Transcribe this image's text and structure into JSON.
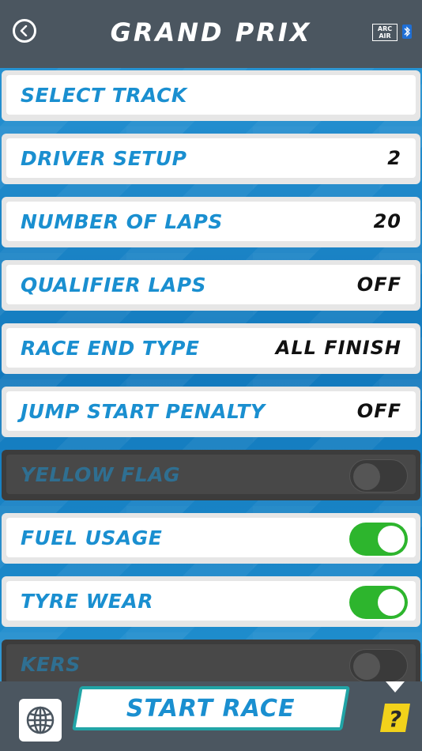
{
  "header": {
    "title": "GRAND PRIX",
    "logo_line1": "ARC",
    "logo_line2": "AIR"
  },
  "settings": [
    {
      "label": "SELECT TRACK",
      "value": ""
    },
    {
      "label": "DRIVER SETUP",
      "value": "2"
    },
    {
      "label": "NUMBER OF LAPS",
      "value": "20"
    },
    {
      "label": "QUALIFIER LAPS",
      "value": "OFF"
    },
    {
      "label": "RACE END TYPE",
      "value": "ALL FINISH"
    },
    {
      "label": "JUMP START  PENALTY",
      "value": "OFF"
    }
  ],
  "toggles": [
    {
      "label": "YELLOW FLAG",
      "state": "off",
      "enabled": false
    },
    {
      "label": "FUEL USAGE",
      "state": "on",
      "enabled": true
    },
    {
      "label": "TYRE WEAR",
      "state": "on",
      "enabled": true
    },
    {
      "label": "KERS",
      "state": "off",
      "enabled": false
    }
  ],
  "footer": {
    "start_label": "START RACE"
  },
  "colors": {
    "accent_blue": "#1a8fd0",
    "toggle_on": "#2db52d",
    "bar_bg": "#4b5660",
    "start_border": "#21a4a6"
  }
}
